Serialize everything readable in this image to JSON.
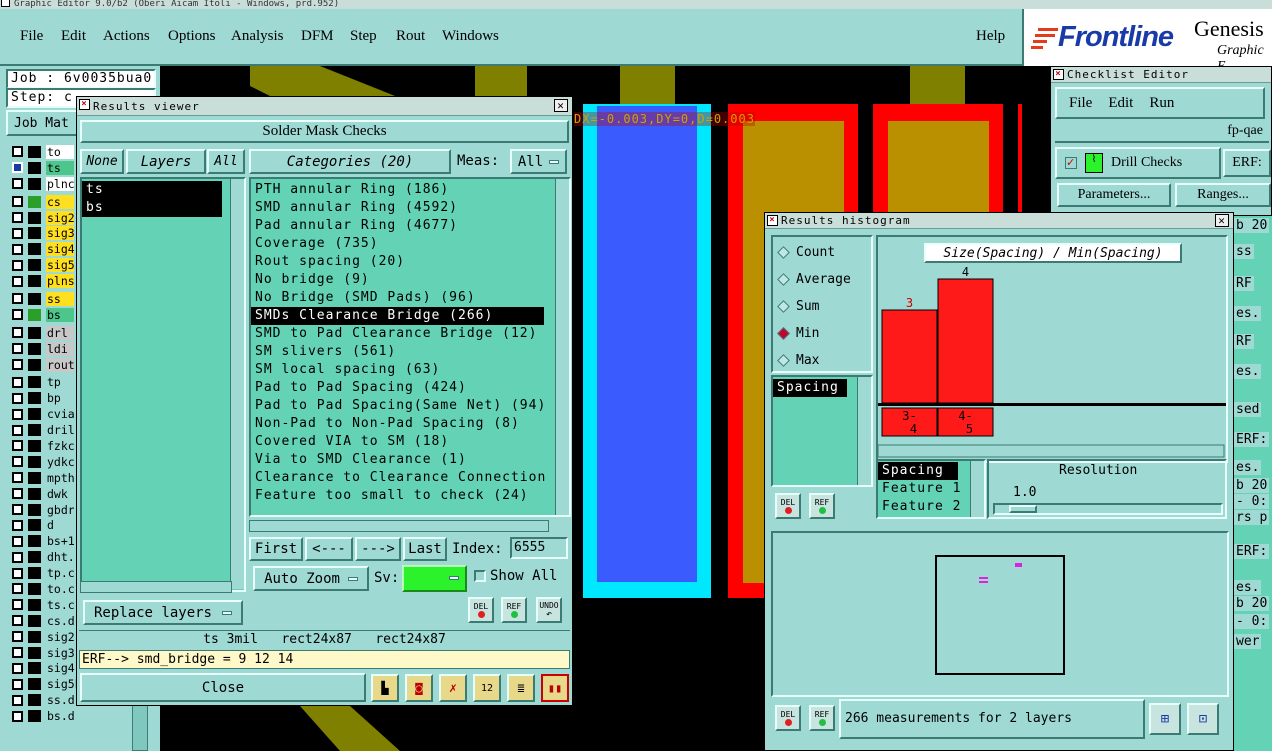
{
  "app": {
    "title": "Graphic Editor 9.0/b2 (Oberi Aicam Itoli - Windows, prd.952)",
    "menu": [
      "File",
      "Edit",
      "Actions",
      "Options",
      "Analysis",
      "DFM",
      "Step",
      "Rout",
      "Windows"
    ],
    "help": "Help",
    "brand_name": "Frontline",
    "brand_product": "Genesis",
    "brand_sub": "Graphic E",
    "job_label": "Job : 6v0035bua0",
    "step_label": "Step: c",
    "job_mat_label": "Job Mat"
  },
  "layers": [
    {
      "name": "to",
      "color": "#ffffff"
    },
    {
      "name": "ts",
      "color": "#4dc68c"
    },
    {
      "name": "plnc",
      "color": "#ffffff"
    },
    {
      "name": "cs",
      "color": "#ffe020"
    },
    {
      "name": "sig2",
      "color": "#ffe020"
    },
    {
      "name": "sig3",
      "color": "#ffe020"
    },
    {
      "name": "sig4",
      "color": "#ffe020"
    },
    {
      "name": "sig5",
      "color": "#ffe020"
    },
    {
      "name": "plns",
      "color": "#ffe020"
    },
    {
      "name": "ss",
      "color": "#ffe020"
    },
    {
      "name": "bs",
      "color": "#4dc68c"
    },
    {
      "name": "drl",
      "color": "#c8c8c8"
    },
    {
      "name": "ldi",
      "color": "#c8c8c8"
    },
    {
      "name": "rout",
      "color": "#c8c8c8"
    },
    {
      "name": "tp",
      "color": "#9fd9d4"
    },
    {
      "name": "bp",
      "color": "#9fd9d4"
    },
    {
      "name": "cvia",
      "color": "#9fd9d4"
    },
    {
      "name": "dril",
      "color": "#9fd9d4"
    },
    {
      "name": "fzkc",
      "color": "#9fd9d4"
    },
    {
      "name": "ydkc",
      "color": "#9fd9d4"
    },
    {
      "name": "mpth",
      "color": "#9fd9d4"
    },
    {
      "name": "dwk",
      "color": "#9fd9d4"
    },
    {
      "name": "gbdr",
      "color": "#9fd9d4"
    },
    {
      "name": "d",
      "color": "#9fd9d4"
    },
    {
      "name": "bs+1",
      "color": "#9fd9d4"
    },
    {
      "name": "dht.",
      "color": "#9fd9d4"
    },
    {
      "name": "tp.c",
      "color": "#9fd9d4"
    },
    {
      "name": "to.c",
      "color": "#9fd9d4"
    },
    {
      "name": "ts.c",
      "color": "#9fd9d4"
    },
    {
      "name": "cs.d",
      "color": "#9fd9d4"
    },
    {
      "name": "sig2",
      "color": "#9fd9d4"
    },
    {
      "name": "sig3",
      "color": "#9fd9d4"
    },
    {
      "name": "sig4",
      "color": "#9fd9d4"
    },
    {
      "name": "sig5b.d",
      "color": "#9fd9d4"
    },
    {
      "name": "ss.d",
      "color": "#9fd9d4"
    },
    {
      "name": "bs.d",
      "color": "#9fd9d4"
    }
  ],
  "canvas": {
    "measure_text": "DX=-0.003,DY=0,D=0.003"
  },
  "results_viewer": {
    "title": "Results viewer",
    "header": "Solder Mask Checks",
    "none_btn": "None",
    "layers_btn": "Layers",
    "all_btn": "All",
    "layer_list": [
      "ts",
      "bs"
    ],
    "categories_btn": "Categories (20)",
    "meas_label": "Meas:",
    "meas_value": "All",
    "categories": [
      "PTH annular Ring (186)",
      "SMD annular Ring (4592)",
      "Pad annular Ring (4677)",
      "Coverage (735)",
      "Rout spacing (20)",
      "No bridge (9)",
      "No Bridge (SMD Pads) (96)",
      "SMDs Clearance Bridge (266)",
      "SMD to Pad Clearance Bridge (12)",
      "SM slivers (561)",
      "SM local spacing (63)",
      "Pad to Pad Spacing (424)",
      "Pad to Pad Spacing(Same Net) (94)",
      "Non-Pad to Non-Pad Spacing (8)",
      "Covered VIA to SM (18)",
      "Via to SMD Clearance (1)",
      "Clearance to Clearance Connection",
      "Feature too small to check (24)"
    ],
    "selected_index": 7,
    "first_btn": "First",
    "prev_btn": "<---",
    "next_btn": "--->",
    "last_btn": "Last",
    "index_label": "Index:",
    "index_value": "6555",
    "auto_zoom": "Auto Zoom",
    "sv_label": "Sv:",
    "show_all": "Show All",
    "replace_layers": "Replace layers",
    "del_label": "DEL",
    "ref_label": "REF",
    "undo_label": "UNDO",
    "status_line": "ts 3mil   rect24x87   rect24x87",
    "erf_line": "ERF--> smd_bridge = 9 12 14",
    "close_btn": "Close"
  },
  "checklist": {
    "title": "Checklist Editor",
    "menu": [
      "File",
      "Edit",
      "Run"
    ],
    "name": "fp-qae",
    "drill_checks": "Drill Checks",
    "erf": "ERF:",
    "parameters": "Parameters...",
    "ranges": "Ranges...",
    "right_fragments": [
      "b 20",
      "ss",
      "RF",
      "es.",
      "RF",
      "es.",
      "sed",
      "ERF:",
      "es.",
      "b 20",
      "- 0:",
      "rs p",
      "ERF:",
      "es.",
      "b 20",
      "- 0:",
      "wer"
    ]
  },
  "histogram": {
    "title": "Results histogram",
    "modes": [
      {
        "label": "Count",
        "selected": false
      },
      {
        "label": "Average",
        "selected": false
      },
      {
        "label": "Sum",
        "selected": false
      },
      {
        "label": "Min",
        "selected": true
      },
      {
        "label": "Max",
        "selected": false
      }
    ],
    "measure_list": [
      "Spacing"
    ],
    "chart_title": "Size(Spacing) / Min(Spacing)",
    "del_label": "DEL",
    "ref_label": "REF",
    "chart_data": {
      "type": "bar",
      "categories": [
        "3-4",
        "4-5"
      ],
      "values": [
        3,
        4
      ],
      "title": "Size(Spacing) / Min(Spacing)",
      "color": "#ff1a1a"
    },
    "sort_list": [
      "Spacing",
      "Feature 1",
      "Feature 2"
    ],
    "resolution_label": "Resolution",
    "resolution_value": "1.0",
    "summary": "266 measurements for 2 layers"
  }
}
